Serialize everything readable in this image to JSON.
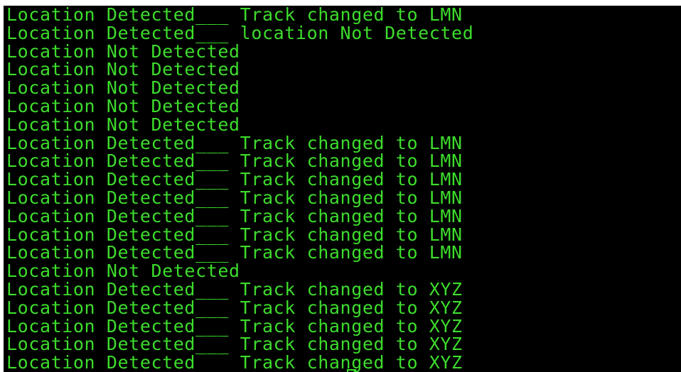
{
  "terminal": {
    "text_color": "#3ddc2c",
    "background_color": "#000000",
    "lines": [
      "Location Detected___ Track changed to LMN",
      "Location Detected___ location Not Detected",
      "Location Not Detected",
      "Location Not Detected",
      "Location Not Detected",
      "Location Not Detected",
      "Location Not Detected",
      "Location Detected___ Track changed to LMN",
      "Location Detected___ Track changed to LMN",
      "Location Detected___ Track changed to LMN",
      "Location Detected___ Track changed to LMN",
      "Location Detected___ Track changed to LMN",
      "Location Detected___ Track changed to LMN",
      "Location Detected___ Track changed to LMN",
      "Location Not Detected",
      "Location Detected___ Track changed to XYZ",
      "Location Detected___ Track changed to XYZ",
      "Location Detected___ Track changed to XYZ",
      "Location Detected___ Track changed to XYZ",
      "Location Detected___ Track changed to XYZ"
    ]
  }
}
